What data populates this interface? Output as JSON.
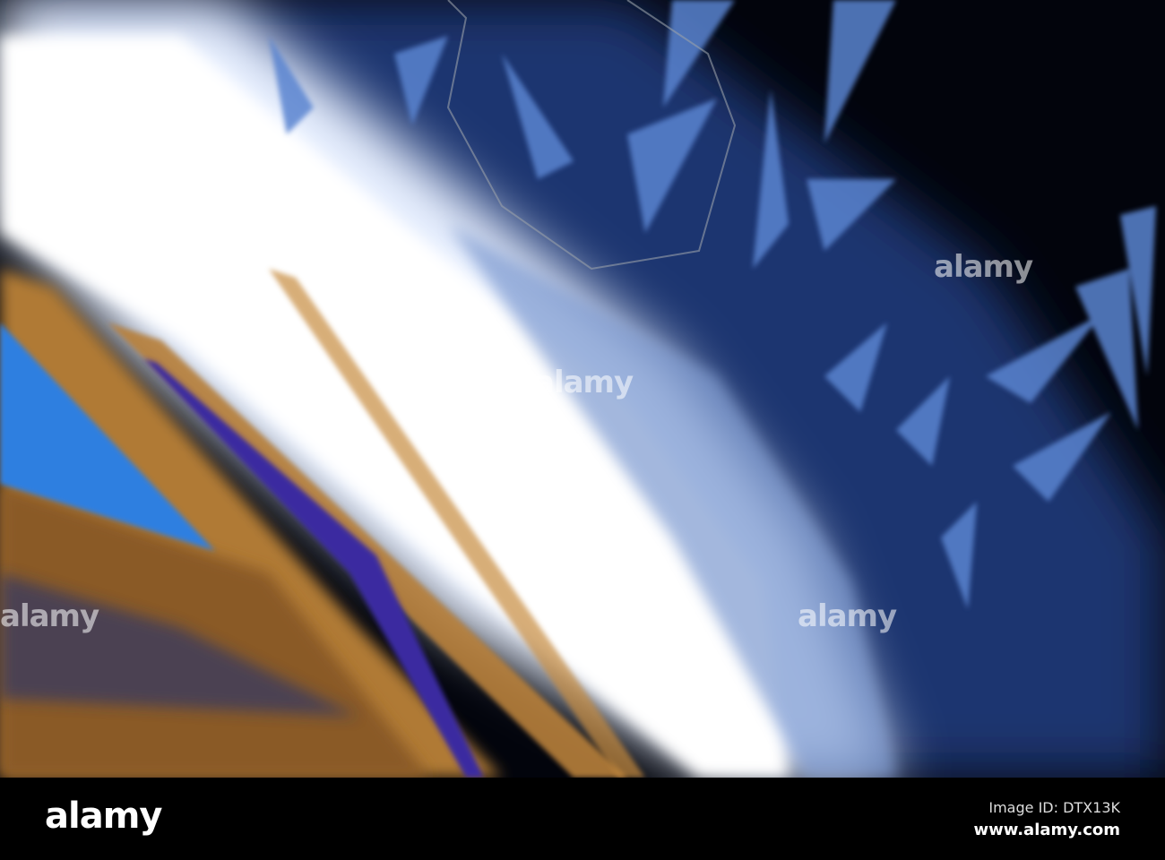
{
  "watermarks": [
    "alamy",
    "alamy",
    "alamy",
    "alamy",
    "alamy"
  ],
  "footer": {
    "logo": "alamy",
    "image_id": "Image ID: DTX13K",
    "url": "www.alamy.com"
  },
  "colors": {
    "background": "#02040c",
    "crystal_blue": "#3a64b8",
    "highlight": "#f4f8ff",
    "amber": "#b8803a"
  }
}
